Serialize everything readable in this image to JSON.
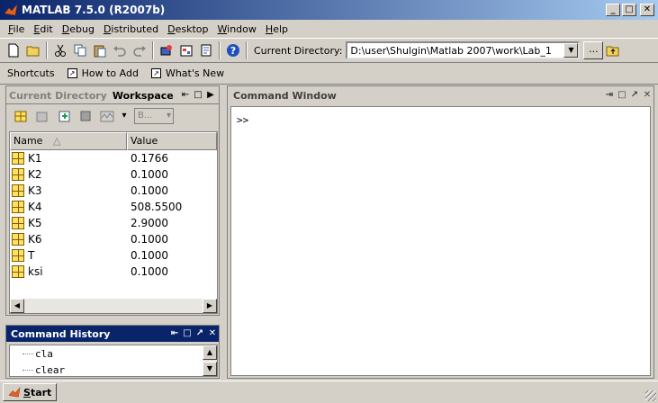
{
  "window": {
    "title": "MATLAB  7.5.0 (R2007b)",
    "min_label": "_",
    "max_label": "□",
    "close_label": "✕"
  },
  "menu": {
    "items": [
      {
        "accel": "F",
        "rest": "ile"
      },
      {
        "accel": "E",
        "rest": "dit"
      },
      {
        "accel": "D",
        "rest": "ebug"
      },
      {
        "accel": "D",
        "rest": "istributed"
      },
      {
        "accel": "D",
        "rest": "esktop"
      },
      {
        "accel": "W",
        "rest": "indow"
      },
      {
        "accel": "H",
        "rest": "elp"
      }
    ]
  },
  "toolbar": {
    "current_dir_label": "Current Directory:",
    "current_dir_value": "D:\\user\\Shulgin\\Matlab 2007\\work\\Lab_1",
    "browse_label": "..."
  },
  "shortcuts": {
    "label": "Shortcuts",
    "items": [
      "How to Add",
      "What's New"
    ]
  },
  "workspace": {
    "tab_current_directory": "Current Directory",
    "tab_workspace": "Workspace",
    "stack_label": "B...",
    "columns": [
      "Name",
      "Value"
    ],
    "sort_indicator": "△",
    "variables": [
      {
        "name": "K1",
        "value": "0.1766"
      },
      {
        "name": "K2",
        "value": "0.1000"
      },
      {
        "name": "K3",
        "value": "0.1000"
      },
      {
        "name": "K4",
        "value": "508.5500"
      },
      {
        "name": "K5",
        "value": "2.9000"
      },
      {
        "name": "K6",
        "value": "0.1000"
      },
      {
        "name": "T",
        "value": "0.1000"
      },
      {
        "name": "ksi",
        "value": "0.1000"
      }
    ]
  },
  "command_history": {
    "title": "Command History",
    "entries": [
      "cla",
      "clear"
    ]
  },
  "command_window": {
    "title": "Command Window",
    "prompt": ">>"
  },
  "statusbar": {
    "start_accel": "S",
    "start_rest": "tart"
  }
}
